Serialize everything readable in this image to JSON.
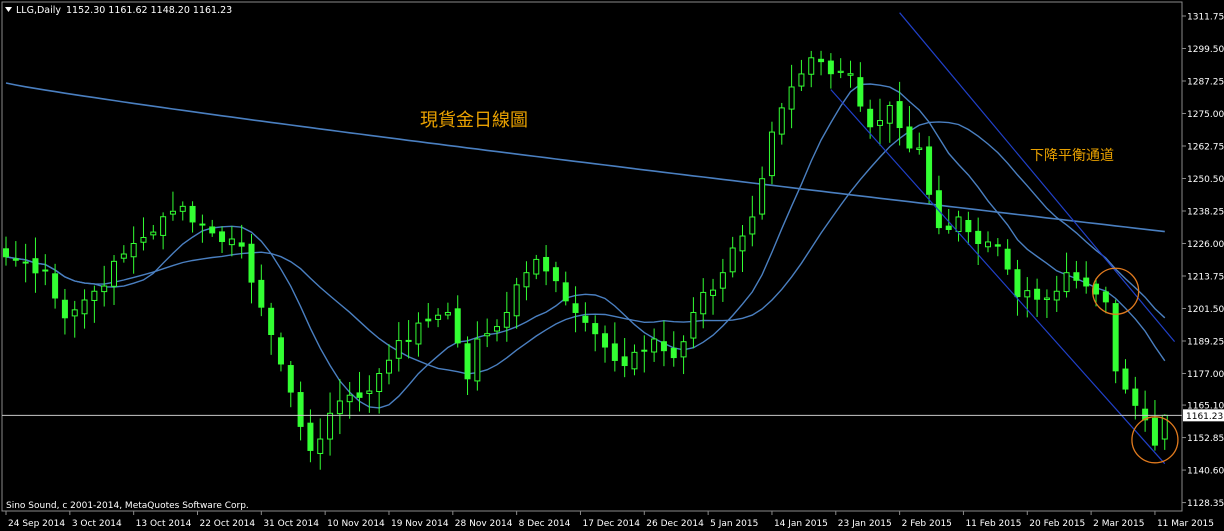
{
  "header": {
    "symbol": "LLG,Daily",
    "ohlc": "1152.30 1161.62 1148.20 1161.23"
  },
  "copyright": "Sino Sound, c 2001-2014, MetaQuotes Software Corp.",
  "current_price_label": "1161.23",
  "annotations": {
    "spot_gold_daily": "現貨金日線圖",
    "descending_channel": "下降平衡通道"
  },
  "colors": {
    "background": "#000000",
    "candle": "#33ff33",
    "ma_line": "#4a7fc0",
    "channel": "#2040c8",
    "circle": "#e07a1e",
    "annotation": "#e8a000",
    "text": "#ffffff",
    "current_price_line": "#c8c8c8"
  },
  "chart_data": {
    "type": "candlestick",
    "title": "LLG,Daily",
    "ylim": [
      1128.35,
      1317.0
    ],
    "y_ticks": [
      "1311.75",
      "1299.50",
      "1287.25",
      "1275.00",
      "1262.75",
      "1250.50",
      "1238.25",
      "1226.00",
      "1213.75",
      "1201.50",
      "1189.25",
      "1177.00",
      "1165.10",
      "1152.85",
      "1140.60",
      "1128.35"
    ],
    "x_tick_labels": [
      "24 Sep 2014",
      "3 Oct 2014",
      "13 Oct 2014",
      "22 Oct 2014",
      "31 Oct 2014",
      "10 Nov 2014",
      "19 Nov 2014",
      "28 Nov 2014",
      "8 Dec 2014",
      "17 Dec 2014",
      "26 Dec 2014",
      "5 Jan 2015",
      "14 Jan 2015",
      "23 Jan 2015",
      "2 Feb 2015",
      "11 Feb 2015",
      "20 Feb 2015",
      "2 Mar 2015",
      "11 Mar 2015"
    ],
    "close_anchors": [
      {
        "bar": 0,
        "close": 1221
      },
      {
        "bar": 4,
        "close": 1216
      },
      {
        "bar": 6,
        "close": 1198
      },
      {
        "bar": 9,
        "close": 1208
      },
      {
        "bar": 13,
        "close": 1226
      },
      {
        "bar": 18,
        "close": 1240
      },
      {
        "bar": 21,
        "close": 1230
      },
      {
        "bar": 24,
        "close": 1225
      },
      {
        "bar": 26,
        "close": 1202
      },
      {
        "bar": 29,
        "close": 1170
      },
      {
        "bar": 31,
        "close": 1148
      },
      {
        "bar": 33,
        "close": 1162
      },
      {
        "bar": 36,
        "close": 1168
      },
      {
        "bar": 39,
        "close": 1182
      },
      {
        "bar": 42,
        "close": 1196
      },
      {
        "bar": 45,
        "close": 1200
      },
      {
        "bar": 47,
        "close": 1175
      },
      {
        "bar": 48,
        "close": 1190
      },
      {
        "bar": 51,
        "close": 1200
      },
      {
        "bar": 53,
        "close": 1215
      },
      {
        "bar": 54,
        "close": 1220
      },
      {
        "bar": 56,
        "close": 1212
      },
      {
        "bar": 58,
        "close": 1200
      },
      {
        "bar": 60,
        "close": 1192
      },
      {
        "bar": 63,
        "close": 1180
      },
      {
        "bar": 66,
        "close": 1190
      },
      {
        "bar": 68,
        "close": 1183
      },
      {
        "bar": 70,
        "close": 1200
      },
      {
        "bar": 73,
        "close": 1215
      },
      {
        "bar": 76,
        "close": 1236
      },
      {
        "bar": 78,
        "close": 1268
      },
      {
        "bar": 80,
        "close": 1285
      },
      {
        "bar": 82,
        "close": 1296
      },
      {
        "bar": 84,
        "close": 1290
      },
      {
        "bar": 86,
        "close": 1290
      },
      {
        "bar": 88,
        "close": 1270
      },
      {
        "bar": 90,
        "close": 1278
      },
      {
        "bar": 92,
        "close": 1262
      },
      {
        "bar": 93,
        "close": 1262
      },
      {
        "bar": 95,
        "close": 1232
      },
      {
        "bar": 97,
        "close": 1236
      },
      {
        "bar": 99,
        "close": 1226
      },
      {
        "bar": 101,
        "close": 1225
      },
      {
        "bar": 103,
        "close": 1206
      },
      {
        "bar": 105,
        "close": 1205
      },
      {
        "bar": 107,
        "close": 1208
      },
      {
        "bar": 108,
        "close": 1215
      },
      {
        "bar": 110,
        "close": 1210
      },
      {
        "bar": 112,
        "close": 1204
      },
      {
        "bar": 113,
        "close": 1178
      },
      {
        "bar": 115,
        "close": 1165
      },
      {
        "bar": 117,
        "close": 1150
      },
      {
        "bar": 118,
        "close": 1161.23
      }
    ],
    "last_bar": {
      "open": 1152.3,
      "high": 1161.62,
      "low": 1148.2,
      "close": 1161.23
    },
    "moving_average_periods": [
      10,
      20,
      200
    ],
    "channel": {
      "upper": [
        {
          "bar": 91,
          "price": 1313
        },
        {
          "bar": 119,
          "price": 1189
        }
      ],
      "lower": [
        {
          "bar": 84,
          "price": 1284
        },
        {
          "bar": 118,
          "price": 1143
        }
      ]
    },
    "highlight_circles": [
      {
        "bar": 113,
        "price": 1208
      },
      {
        "bar": 117,
        "price": 1152
      }
    ]
  }
}
